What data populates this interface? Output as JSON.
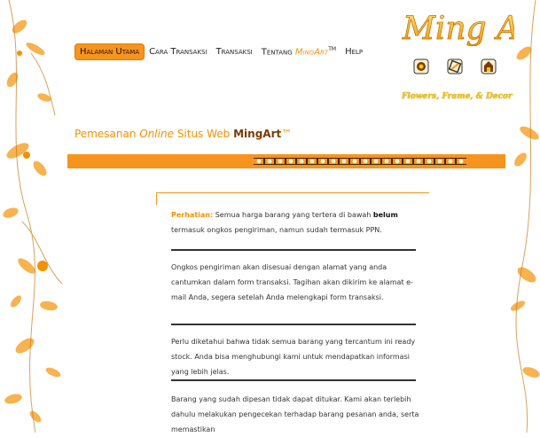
{
  "nav": {
    "items": [
      {
        "label": "Halaman Utama",
        "active": true
      },
      {
        "label": "Cara Transaksi",
        "active": false
      },
      {
        "label": "Transaksi",
        "active": false
      },
      {
        "label_prefix": "Tentang ",
        "label_brand": "MingArt",
        "label_sup": "TM",
        "active": false
      },
      {
        "label": "Help",
        "active": false
      }
    ]
  },
  "logo": {
    "text": "Ming Art"
  },
  "tagline": "Flowers, Frame, & Decor",
  "heading": {
    "part1": "Pemesanan ",
    "part2": "Online",
    "part3": " Situs Web ",
    "brand_ming": "Ming",
    "brand_art": "Art",
    "tm": "™"
  },
  "notes": {
    "p1_label": "Perhatian:",
    "p1_text_a": " Semua harga barang yang tertera di bawah ",
    "p1_bold": "belum",
    "p1_text_b": " termasuk ongkos pengiriman, namun sudah termasuk PPN.",
    "p2": "Ongkos pengiriman akan disesuai dengan alamat yang anda cantumkan dalam form transaksi. Tagihan akan dikirim ke alamat e-mail Anda, segera setelah Anda melengkapi form transaksi.",
    "p3": "Perlu diketahui bahwa tidak semua barang yang tercantum ini ready stock. Anda bisa menghubungi kami untuk mendapatkan informasi yang lebih jelas.",
    "p4": "Barang yang sudah dipesan tidak dapat ditukar. Kami akan terlebih dahulu melakukan pengecekan terhadap barang pesanan anda, serta memastikan"
  },
  "colors": {
    "accent": "#f7941d",
    "brand_dark": "#7a3b00",
    "gold": "#f7c800"
  }
}
